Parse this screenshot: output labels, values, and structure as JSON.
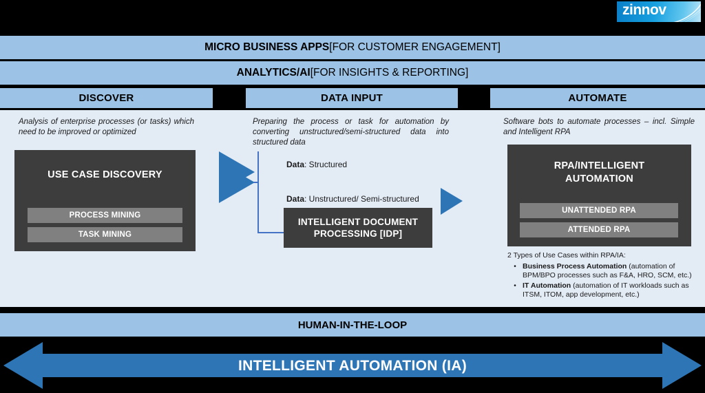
{
  "logo": {
    "text": "zinnov",
    "swoosh_icon": "swoosh-arc-icon",
    "gradient_start": "#0a7fc8",
    "gradient_end": "#bce4f6"
  },
  "banners": [
    {
      "bold": "MICRO BUSINESS APPS",
      "normal": " [FOR CUSTOMER ENGAGEMENT]"
    },
    {
      "bold": "ANALYTICS/AI",
      "normal": " [FOR INSIGHTS & REPORTING]"
    }
  ],
  "columns": {
    "discover": {
      "header": "DISCOVER",
      "description": "Analysis of enterprise processes (or tasks) which need to be improved or optimized",
      "box": {
        "title": "USE CASE DISCOVERY",
        "items": [
          "PROCESS MINING",
          "TASK MINING"
        ]
      }
    },
    "data_input": {
      "header": "DATA INPUT",
      "description": "Preparing the process or task for automation by converting unstructured/semi-structured data into structured data",
      "labels": {
        "structured_bold": "Data",
        "structured_rest": ": Structured",
        "unstructured_bold": "Data",
        "unstructured_rest": ": Unstructured/ Semi-structured"
      },
      "box": {
        "title_line1": "INTELLIGENT DOCUMENT",
        "title_line2": "PROCESSING [IDP]"
      }
    },
    "automate": {
      "header": "AUTOMATE",
      "description": "Software bots to automate processes – incl. Simple and Intelligent RPA",
      "box": {
        "title_line1": "RPA/INTELLIGENT",
        "title_line2": "AUTOMATION",
        "items": [
          "UNATTENDED RPA",
          "ATTENDED RPA"
        ]
      },
      "notes": {
        "intro": "2 Types of Use Cases within RPA/IA:",
        "bullets": [
          {
            "bold": "Business Process Automation",
            "rest": " (automation of BPM/BPO processes such as F&A, HRO, SCM, etc.)"
          },
          {
            "bold": "IT Automation",
            "rest": " (automation of IT workloads such as ITSM, ITOM, app development, etc.)"
          }
        ]
      }
    }
  },
  "footer": {
    "human_in_the_loop": "HUMAN-IN-THE-LOOP",
    "intelligent_automation": "INTELLIGENT AUTOMATION (IA)"
  },
  "colors": {
    "background": "#000000",
    "banner_blue": "#9cc3e5",
    "panel_light": "#e3ebf5",
    "dark_box": "#3d3d3d",
    "gray_bar": "#808080",
    "arrow_blue": "#2e75b6",
    "line_blue": "#4472c4"
  }
}
